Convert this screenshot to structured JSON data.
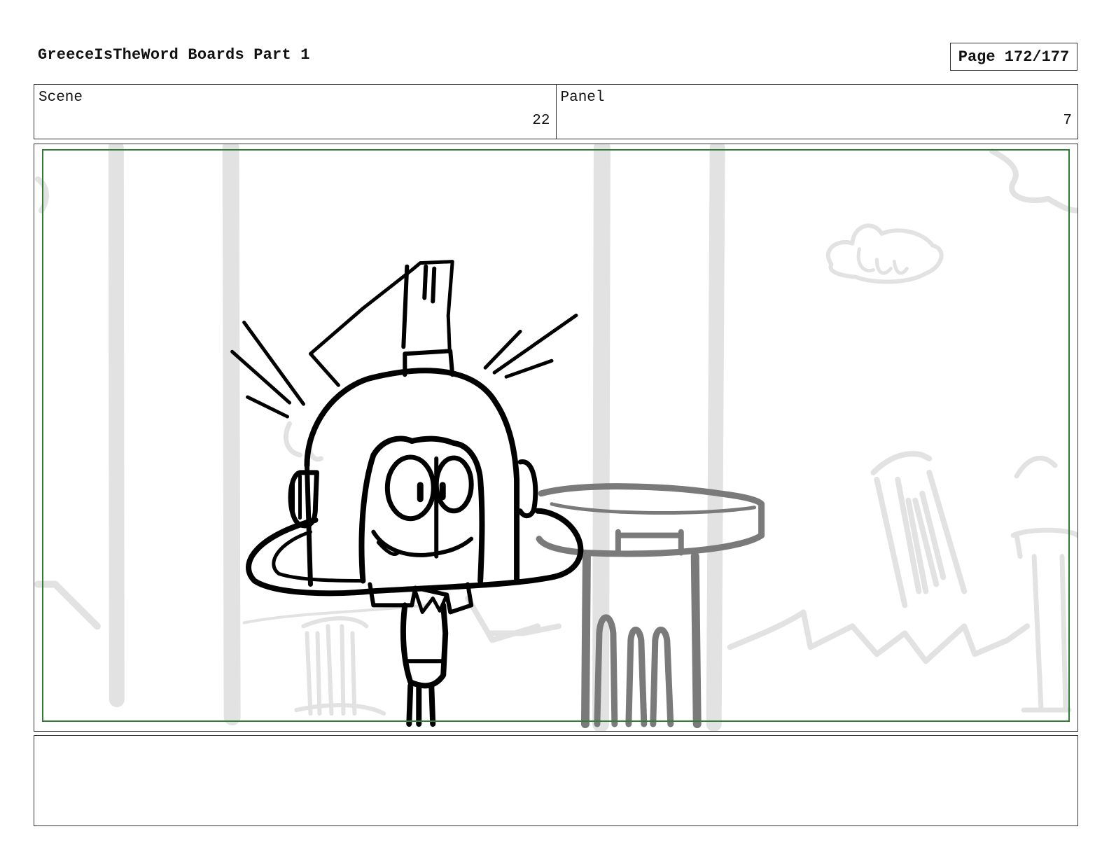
{
  "header": {
    "title": "GreeceIsTheWord Boards Part 1",
    "page_label": "Page 172/177"
  },
  "info": {
    "scene_label": "Scene",
    "scene_value": "22",
    "panel_label": "Panel",
    "panel_value": "7"
  },
  "panel": {
    "description_icons": [
      "helmeted-character-icon",
      "greek-column-icon",
      "cloud-icon",
      "motion-lines-icon"
    ]
  },
  "notes": {
    "text": ""
  },
  "colors": {
    "safe_area": "#2e7d32",
    "background_sketch": "#e2e2e2",
    "midground_sketch": "#7a7a7a",
    "foreground_ink": "#000000"
  }
}
